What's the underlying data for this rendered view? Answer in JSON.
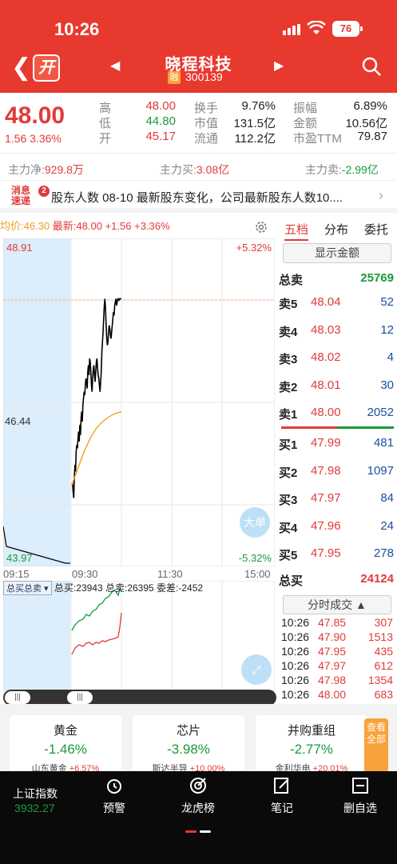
{
  "status": {
    "time": "10:26",
    "battery": "76"
  },
  "nav": {
    "name": "晓程科技",
    "rong": "融",
    "code": "300139"
  },
  "quote": {
    "price": "48.00",
    "change": "1.56",
    "change_pct": "3.36%",
    "stats": [
      {
        "label": "高",
        "value": "48.00",
        "color": "red"
      },
      {
        "label": "低",
        "value": "44.80",
        "color": "green"
      },
      {
        "label": "开",
        "value": "45.17",
        "color": "red"
      },
      {
        "label": "换手",
        "value": "9.76%",
        "color": "dark"
      },
      {
        "label": "市值",
        "value": "131.5亿",
        "color": "dark"
      },
      {
        "label": "流通",
        "value": "112.2亿",
        "color": "dark"
      },
      {
        "label": "振幅",
        "value": "6.89%",
        "color": "dark"
      },
      {
        "label": "金额",
        "value": "10.56亿",
        "color": "dark"
      },
      {
        "label": "市盈TTM",
        "value": "79.87",
        "color": "dark"
      }
    ]
  },
  "flow": {
    "net_label": "主力净:",
    "net_value": "929.8万",
    "buy_label": "主力买:",
    "buy_value": "3.08亿",
    "sell_label": "主力卖:",
    "sell_value": "-2.99亿"
  },
  "news": {
    "badge_top": "消息",
    "badge_bottom": "速递",
    "count": "2",
    "text": "股东人数   08-10 最新股东变化，公司最新股东人数10...."
  },
  "chart_header": {
    "avg_label": "均价:",
    "avg_value": "46.30",
    "last_label": "最新:",
    "last_value": "48.00",
    "last_chg": "+1.56",
    "last_pct": "+3.36%"
  },
  "chart_labels": {
    "price_top": "48.91",
    "price_mid": "46.44",
    "price_bottom": "43.97",
    "pct_top": "+5.32%",
    "pct_bottom": "-5.32%",
    "times": [
      "09:15",
      "09:30",
      "11:30",
      "15:00"
    ],
    "big_order": "大单"
  },
  "chart_data": {
    "type": "line",
    "title": "",
    "xlabel": "",
    "ylabel": "",
    "ylim": [
      43.97,
      48.91
    ],
    "x_ticks": [
      "09:15",
      "09:30",
      "11:30",
      "15:00"
    ],
    "series": [
      {
        "name": "最新",
        "color": "#000000",
        "x": [
          0,
          1,
          2,
          3,
          4,
          5,
          6,
          7,
          8,
          9,
          10,
          11,
          12,
          13,
          14,
          15,
          16,
          17,
          18,
          19,
          20,
          21,
          22,
          23,
          24,
          25,
          26,
          27,
          28,
          29,
          30,
          31,
          32,
          33,
          34,
          35,
          36,
          37,
          38,
          39,
          40,
          41,
          42,
          43,
          44,
          45,
          46,
          47,
          48,
          49,
          50,
          51,
          52,
          53,
          54,
          55,
          56,
          57,
          58,
          59,
          60,
          61,
          62,
          63,
          64,
          65,
          66,
          67,
          68,
          69,
          70,
          71,
          72,
          73,
          74,
          75,
          76,
          77,
          78,
          79,
          80,
          81
        ],
        "y": [
          45.2,
          45.22,
          45.1,
          45.0,
          45.3,
          45.5,
          45.4,
          45.7,
          45.8,
          45.75,
          45.9,
          46.0,
          45.85,
          46.1,
          45.95,
          46.2,
          46.3,
          46.15,
          46.4,
          46.5,
          46.6,
          46.55,
          46.7,
          46.8,
          46.75,
          46.65,
          46.9,
          47.0,
          46.85,
          47.1,
          47.05,
          46.9,
          46.7,
          46.6,
          46.8,
          46.95,
          47.0,
          46.85,
          46.75,
          46.9,
          47.05,
          47.1,
          46.95,
          46.85,
          46.8,
          46.7,
          46.6,
          46.75,
          46.9,
          47.2,
          47.35,
          47.5,
          47.7,
          47.9,
          48.0,
          47.85,
          47.6,
          47.4,
          47.3,
          47.35,
          47.5,
          47.6,
          47.55,
          47.45,
          47.4,
          47.5,
          47.6,
          47.7,
          47.8,
          47.75,
          47.9,
          47.95,
          48.0,
          47.9,
          47.95,
          48.0,
          48.0,
          47.98,
          48.0,
          48.0,
          48.0,
          48.0
        ]
      },
      {
        "name": "均价",
        "color": "#f0a020",
        "x": [
          0,
          10,
          20,
          30,
          40,
          50,
          60,
          70,
          81
        ],
        "y": [
          45.2,
          45.45,
          45.7,
          45.9,
          46.05,
          46.15,
          46.22,
          46.27,
          46.3
        ]
      }
    ]
  },
  "volume": {
    "selector": "总买总卖",
    "buy_label": "总买:",
    "buy_value": "23943",
    "sell_label": "总卖:",
    "sell_value": "26395",
    "diff_label": "委差:",
    "diff_value": "-2452"
  },
  "orderbook": {
    "tabs": [
      "五档",
      "分布",
      "委托"
    ],
    "show_amount": "显示金额",
    "total_sell_label": "总卖",
    "total_sell": "25769",
    "sells": [
      {
        "label": "卖5",
        "price": "48.04",
        "vol": "52"
      },
      {
        "label": "卖4",
        "price": "48.03",
        "vol": "12"
      },
      {
        "label": "卖3",
        "price": "48.02",
        "vol": "4"
      },
      {
        "label": "卖2",
        "price": "48.01",
        "vol": "30"
      },
      {
        "label": "卖1",
        "price": "48.00",
        "vol": "2052"
      }
    ],
    "buys": [
      {
        "label": "买1",
        "price": "47.99",
        "vol": "481"
      },
      {
        "label": "买2",
        "price": "47.98",
        "vol": "1097"
      },
      {
        "label": "买3",
        "price": "47.97",
        "vol": "84"
      },
      {
        "label": "买4",
        "price": "47.96",
        "vol": "24"
      },
      {
        "label": "买5",
        "price": "47.95",
        "vol": "278"
      }
    ],
    "total_buy_label": "总买",
    "total_buy": "24124",
    "deal_label": "分时成交"
  },
  "ticks": [
    {
      "time": "10:26",
      "price": "47.85",
      "vol": "307"
    },
    {
      "time": "10:26",
      "price": "47.90",
      "vol": "1513"
    },
    {
      "time": "10:26",
      "price": "47.95",
      "vol": "435"
    },
    {
      "time": "10:26",
      "price": "47.97",
      "vol": "612"
    },
    {
      "time": "10:26",
      "price": "47.98",
      "vol": "1354"
    },
    {
      "time": "10:26",
      "price": "48.00",
      "vol": "683"
    }
  ],
  "sectors": [
    {
      "name": "黄金",
      "pct": "-1.46%",
      "sub_name": "山东黄金",
      "sub_pct": "+6.57%"
    },
    {
      "name": "芯片",
      "pct": "-3.98%",
      "sub_name": "斯达半导",
      "sub_pct": "+10.00%"
    },
    {
      "name": "并购重组",
      "pct": "-2.77%",
      "sub_name": "金利华电",
      "sub_pct": "+20.01%"
    }
  ],
  "view_all": "查看全部",
  "bottom": {
    "index_name": "上证指数",
    "index_value": "3932.27",
    "items": [
      "预警",
      "龙虎榜",
      "笔记",
      "删自选"
    ]
  }
}
